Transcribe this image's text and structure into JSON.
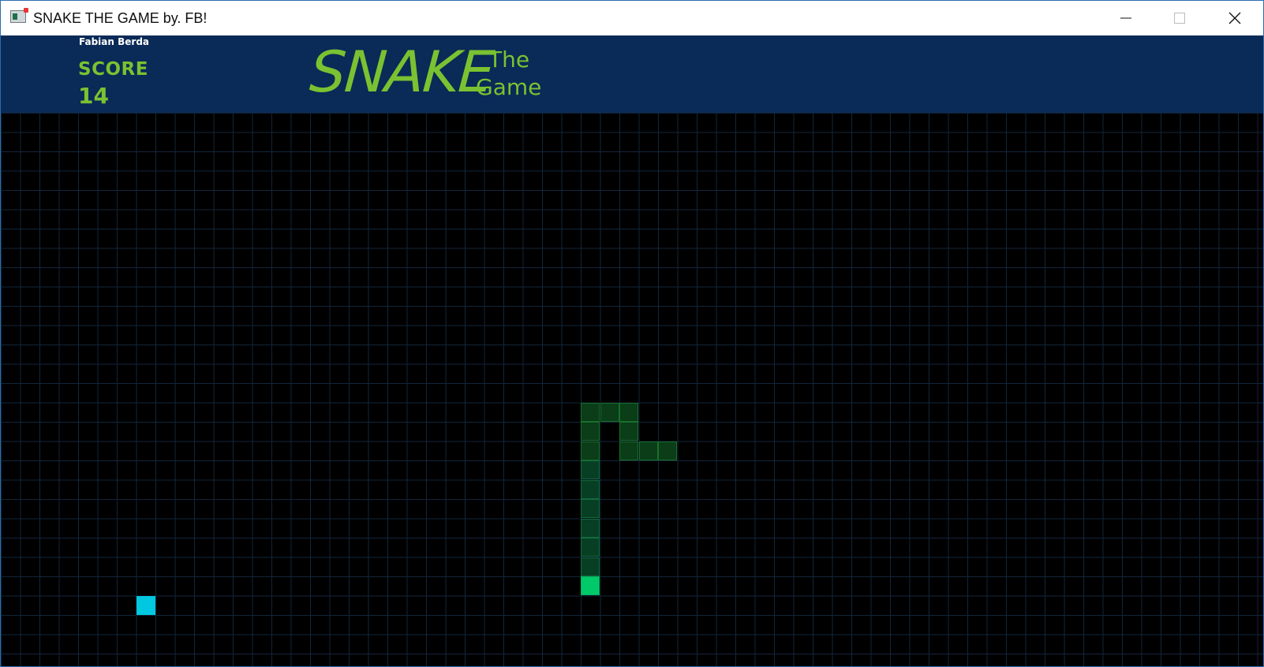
{
  "window": {
    "title": "SNAKE THE GAME by. FB!",
    "icon": "app-window-icon",
    "controls": [
      "minimize-icon",
      "maximize-icon",
      "close-icon"
    ]
  },
  "header": {
    "author": "Fabian Berda",
    "score_label": "SCORE",
    "score_value": "14",
    "logo_main": "SNAKE",
    "logo_sub_1": "The",
    "logo_sub_2": "Game"
  },
  "board": {
    "grid_cols": 64,
    "grid_rows": 28,
    "colors": {
      "background": "#000000",
      "grid_line": "#12263a",
      "snake_body": "#0a3d18",
      "snake_head": "#00c96a",
      "food": "#00c8e0"
    },
    "snake": [
      {
        "col": 34,
        "row": 17
      },
      {
        "col": 33,
        "row": 17
      },
      {
        "col": 32,
        "row": 17
      },
      {
        "col": 32,
        "row": 16
      },
      {
        "col": 32,
        "row": 15
      },
      {
        "col": 31,
        "row": 15
      },
      {
        "col": 30,
        "row": 15
      },
      {
        "col": 30,
        "row": 16
      },
      {
        "col": 30,
        "row": 17
      },
      {
        "col": 30,
        "row": 18
      },
      {
        "col": 30,
        "row": 19
      },
      {
        "col": 30,
        "row": 20
      },
      {
        "col": 30,
        "row": 21
      },
      {
        "col": 30,
        "row": 22
      },
      {
        "col": 30,
        "row": 23
      },
      {
        "col": 30,
        "row": 24
      }
    ],
    "food": {
      "col": 7,
      "row": 25
    }
  }
}
